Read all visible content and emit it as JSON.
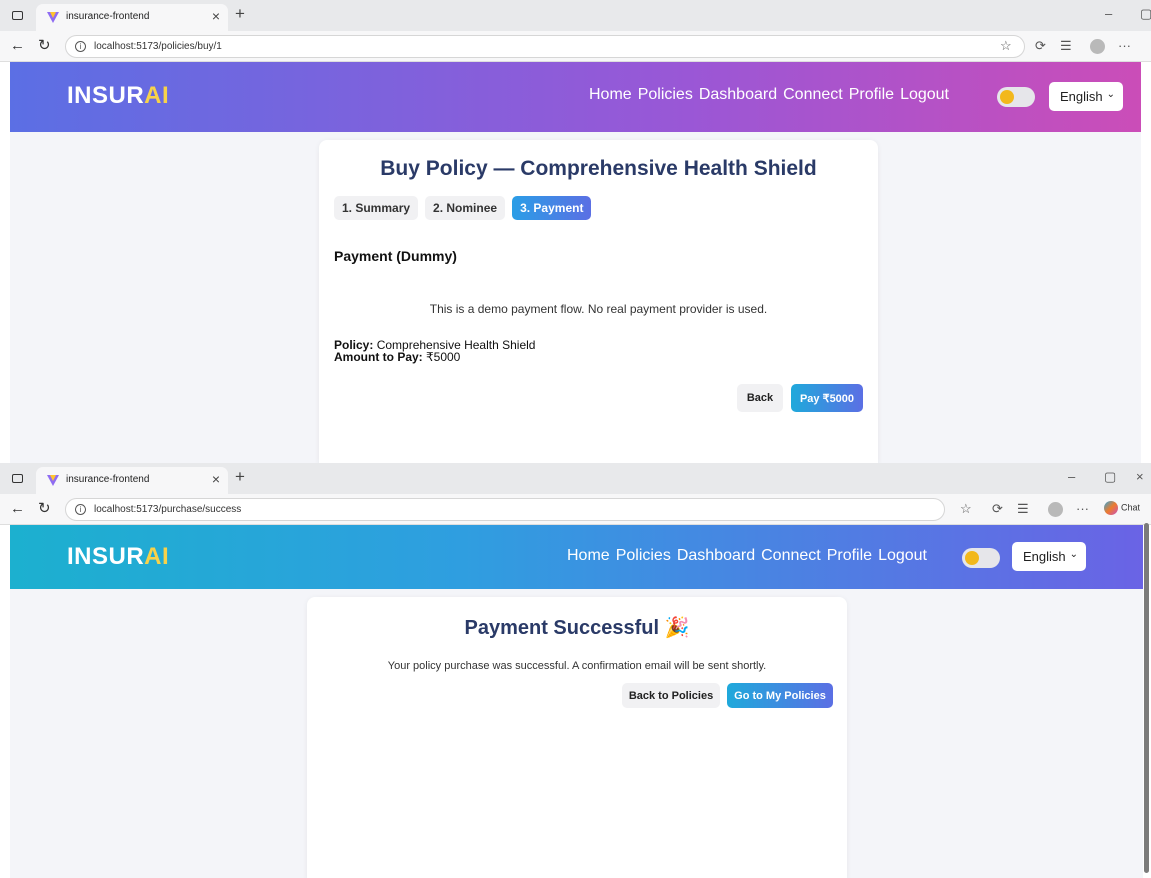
{
  "screens": [
    {
      "browser": {
        "tab_title": "insurance-frontend",
        "url": "localhost:5173/policies/buy/1"
      },
      "header": {
        "brand_main": "INSUR",
        "brand_accent": "AI",
        "nav": [
          "Home",
          "Policies",
          "Dashboard",
          "Connect",
          "Profile",
          "Logout"
        ],
        "language": "English"
      },
      "buy": {
        "title": "Buy Policy — Comprehensive Health Shield",
        "steps": [
          "1. Summary",
          "2. Nominee",
          "3. Payment"
        ],
        "active_step": "3. Payment",
        "section_title": "Payment (Dummy)",
        "note": "This is a demo payment flow. No real payment provider is used.",
        "policy_label": "Policy:",
        "policy_value": "Comprehensive Health Shield",
        "amount_label": "Amount to Pay:",
        "amount_value": "₹5000",
        "back_button": "Back",
        "pay_button": "Pay ₹5000"
      }
    },
    {
      "browser": {
        "tab_title": "insurance-frontend",
        "url": "localhost:5173/purchase/success",
        "chat_label": "Chat"
      },
      "header": {
        "brand_main": "INSUR",
        "brand_accent": "AI",
        "nav": [
          "Home",
          "Policies",
          "Dashboard",
          "Connect",
          "Profile",
          "Logout"
        ],
        "language": "English"
      },
      "success": {
        "title": "Payment Successful 🎉",
        "message": "Your policy purchase was successful. A confirmation email will be sent shortly.",
        "back_button": "Back to Policies",
        "primary_button": "Go to My Policies"
      }
    }
  ],
  "colors": {
    "header1_start": "#5b6fe4",
    "header1_end": "#cb4db8",
    "header2_start": "#1cb0cf",
    "header2_end": "#6a63e5",
    "brand_accent": "#f7d24a",
    "title": "#2a3a67",
    "toggle_knob": "#f2b81c"
  }
}
